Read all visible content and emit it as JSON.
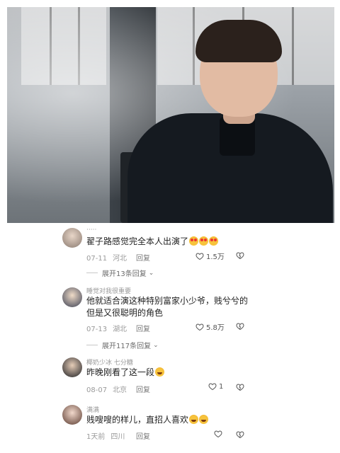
{
  "comments": [
    {
      "username": "·····",
      "text": "翟子路感觉完全本人出演了",
      "emoji": [
        "heart-eyes-emoji",
        "heart-eyes-emoji",
        "heart-eyes-emoji"
      ],
      "date": "07-11",
      "location": "河北",
      "reply_label": "回复",
      "likes": "1.5万",
      "expand_label": "展开13条回复"
    },
    {
      "username": "睡觉对我很重要",
      "text_line1": "他就适合演这种特别富家小少爷，贱兮兮的",
      "text_line2": "但是又很聪明的角色",
      "date": "07-13",
      "location": "湖北",
      "reply_label": "回复",
      "likes": "5.8万",
      "expand_label": "展开117条回复"
    },
    {
      "username": "椰奶少冰 七分糖",
      "text": "昨晚刚看了这一段",
      "emoji": [
        "laugh-cry-emoji"
      ],
      "date": "08-07",
      "location": "北京",
      "reply_label": "回复",
      "likes": "1"
    },
    {
      "username": "满满",
      "text": "贱嗖嗖的样儿，直招人喜欢",
      "emoji": [
        "laugh-cry-emoji",
        "laugh-cry-emoji"
      ],
      "date": "1天前",
      "location": "四川",
      "reply_label": "回复"
    }
  ],
  "icons": {
    "like": "heart-outline-icon",
    "dislike": "broken-heart-icon",
    "expand": "chevron-down-icon"
  },
  "colors": {
    "text": "#222222",
    "secondary": "#9a9a9a",
    "background": "#ffffff"
  }
}
